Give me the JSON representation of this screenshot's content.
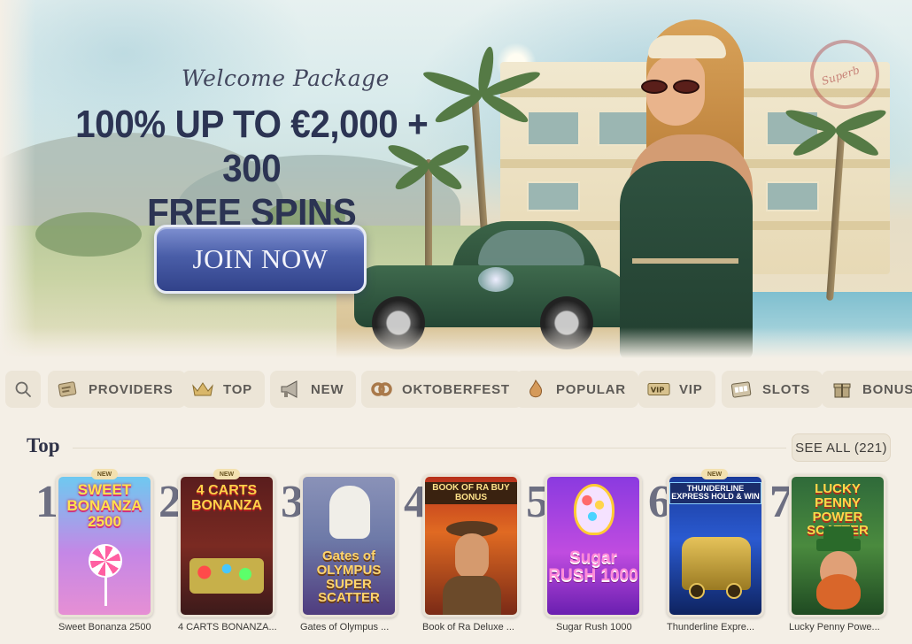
{
  "hero": {
    "welcome_text": "Welcome Package",
    "headline_line1": "100% UP TO €2,000 + 300",
    "headline_line2": "FREE SPINS",
    "cta_label": "JOIN NOW",
    "colors": {
      "headline": "#2c3453",
      "cta": "#4a5ea8"
    }
  },
  "categories": [
    {
      "label": "PROVIDERS",
      "icon": "providers-icon"
    },
    {
      "label": "TOP",
      "icon": "crown-icon"
    },
    {
      "label": "NEW",
      "icon": "megaphone-icon"
    },
    {
      "label": "OKTOBERFEST",
      "icon": "pretzel-icon"
    },
    {
      "label": "POPULAR",
      "icon": "flame-icon"
    },
    {
      "label": "VIP",
      "icon": "vip-icon"
    },
    {
      "label": "SLOTS",
      "icon": "slots-icon"
    },
    {
      "label": "BONUS",
      "icon": "gift-icon"
    }
  ],
  "top": {
    "title": "Top",
    "see_all_label": "SEE ALL (221)",
    "games": [
      {
        "rank": "1",
        "name": "Sweet Bonanza 2500",
        "badge": "NEW",
        "art": "SWEET BONANZA 2500"
      },
      {
        "rank": "2",
        "name": "4 CARTS BONANZA...",
        "badge": "NEW",
        "art": "4 CARTS BONANZA"
      },
      {
        "rank": "3",
        "name": "Gates of Olympus ...",
        "badge": "",
        "art": "Gates of OLYMPUS SUPER SCATTER"
      },
      {
        "rank": "4",
        "name": "Book of Ra Deluxe ...",
        "badge": "",
        "art": "BOOK OF RA BUY BONUS"
      },
      {
        "rank": "5",
        "name": "Sugar Rush 1000",
        "badge": "",
        "art": "Sugar RUSH 1000"
      },
      {
        "rank": "6",
        "name": "Thunderline Expre...",
        "badge": "NEW",
        "art": "THUNDERLINE EXPRESS HOLD & WIN"
      },
      {
        "rank": "7",
        "name": "Lucky Penny Powe...",
        "badge": "",
        "art": "LUCKY PENNY POWER SCATTER"
      }
    ]
  }
}
